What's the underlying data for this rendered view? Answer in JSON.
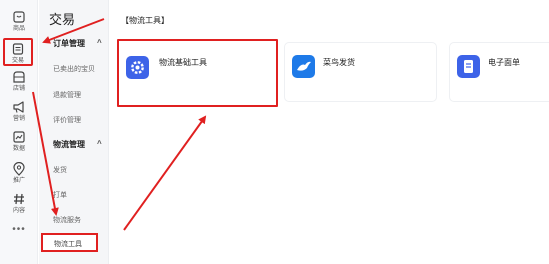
{
  "rail": [
    {
      "name": "rail-item-product",
      "label": "商品",
      "icon": "box-icon"
    },
    {
      "name": "rail-item-trade",
      "label": "交易",
      "icon": "receipt-icon",
      "active": true
    },
    {
      "name": "rail-item-store",
      "label": "店铺",
      "icon": "store-icon"
    },
    {
      "name": "rail-item-marketing",
      "label": "营销",
      "icon": "megaphone-icon"
    },
    {
      "name": "rail-item-data",
      "label": "数据",
      "icon": "chart-icon"
    },
    {
      "name": "rail-item-promotion",
      "label": "推广",
      "icon": "location-icon"
    },
    {
      "name": "rail-item-content",
      "label": "内容",
      "icon": "hashtag-icon"
    }
  ],
  "rail_more": "•••",
  "sidebar": {
    "title": "交易",
    "groups": [
      {
        "label": "订单管理",
        "chevron": "^"
      },
      {
        "label": "物流管理",
        "chevron": "^"
      }
    ],
    "items": [
      {
        "label": "已卖出的宝贝"
      },
      {
        "label": "退款管理"
      },
      {
        "label": "评价管理"
      },
      {
        "label": "发货"
      },
      {
        "label": "打单"
      },
      {
        "label": "物流服务"
      },
      {
        "label": "物流工具"
      }
    ]
  },
  "main": {
    "title": "【物流工具】",
    "cards": [
      {
        "label": "物流基础工具",
        "icon": "gear-icon",
        "color": "#3d63e8"
      },
      {
        "label": "菜鸟发货",
        "icon": "bird-icon",
        "color": "#1e7ae8"
      },
      {
        "label": "电子面单",
        "icon": "document-icon",
        "color": "#3d63e8"
      }
    ]
  },
  "colors": {
    "annotation_red": "#e02020",
    "rail_bg": "#f7f8fa",
    "sidebar_bg": "#f5f6f8"
  }
}
